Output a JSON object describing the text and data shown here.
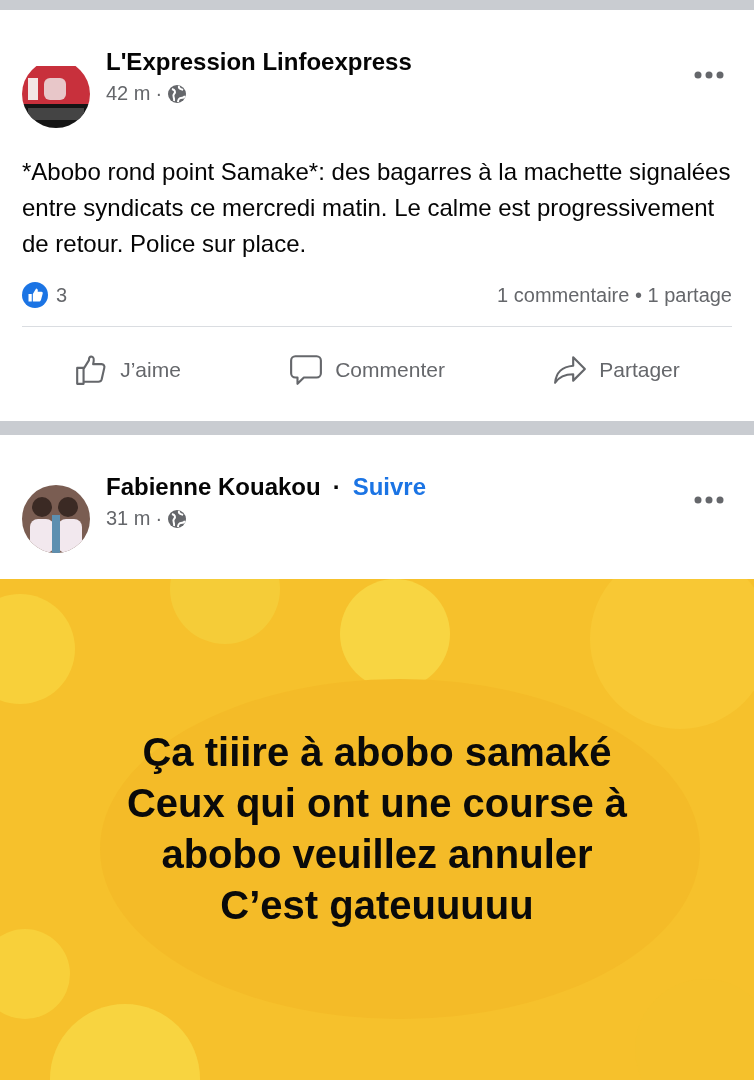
{
  "posts": [
    {
      "author": "L'Expression Linfoexpress",
      "time": "42 m",
      "time_separator": "·",
      "text": "*Abobo rond point Samake*: des bagarres à la machette signalées entre syndicats ce mercredi matin. Le calme est progressivement de retour. Police sur place.",
      "reactions": "3",
      "stats": "1 commentaire • 1 partage",
      "actions": [
        "J’aime",
        "Commenter",
        "Partager"
      ]
    },
    {
      "author": "Fabienne Kouakou",
      "follow_separator": "·",
      "follow": "Suivre",
      "time": "31 m",
      "time_separator": "·",
      "image_text": [
        "Ça tiiire à abobo samaké",
        "Ceux qui ont une course à",
        "abobo veuillez annuler",
        "C’est gateuuuuu"
      ]
    }
  ]
}
